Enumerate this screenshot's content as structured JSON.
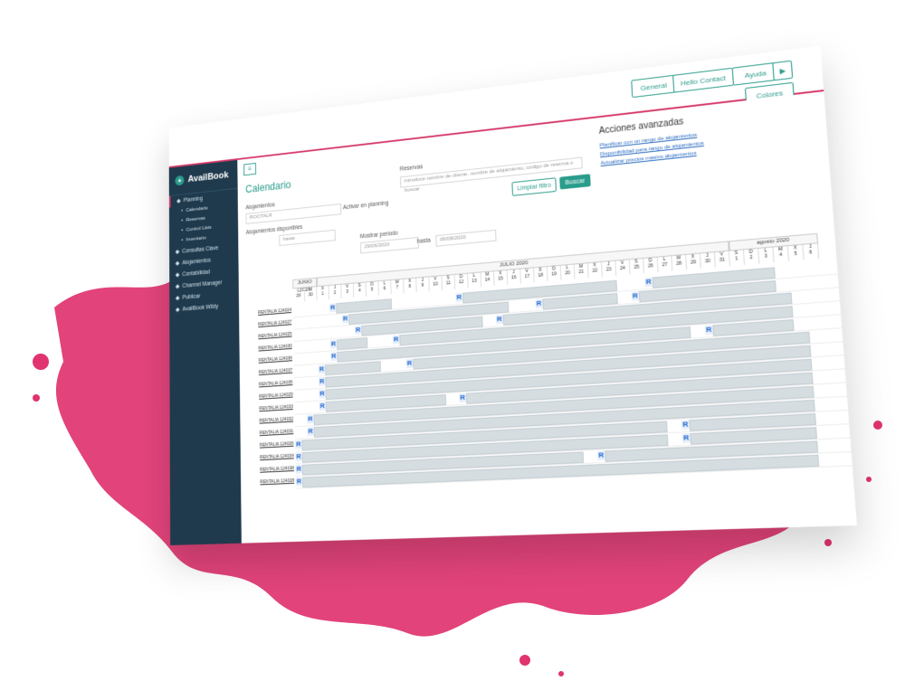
{
  "topbar": {
    "buttons": [
      "General",
      "Hello Contact",
      "Ayuda",
      "▶"
    ],
    "colores": "Colores"
  },
  "sidebar": {
    "logo": "AvailBook",
    "items": [
      {
        "label": "Planning",
        "sub": false,
        "active": true
      },
      {
        "label": "Calendario",
        "sub": true,
        "active": false
      },
      {
        "label": "Reservas",
        "sub": true,
        "active": false
      },
      {
        "label": "Control Lists",
        "sub": true,
        "active": false
      },
      {
        "label": "Inventario",
        "sub": true,
        "active": false
      },
      {
        "label": "Consultas Clave",
        "sub": false,
        "active": false
      },
      {
        "label": "Alojamientos",
        "sub": false,
        "active": false
      },
      {
        "label": "Contabilidad",
        "sub": false,
        "active": false
      },
      {
        "label": "Channel Manager",
        "sub": false,
        "active": false
      },
      {
        "label": "Publicar",
        "sub": false,
        "active": false
      },
      {
        "label": "AvailBook Wildy",
        "sub": false,
        "active": false
      }
    ]
  },
  "main": {
    "title": "Calendario",
    "alojamientos_label": "Alojamientos",
    "alojamientos_value": "ROOTALR",
    "ver_checkbox": "Activar en planning",
    "disponibles_label": "Alojamientos disponibles",
    "hasta": "hasta",
    "reservas_label": "Reservas",
    "reservas_placeholder": "Introduce nombre de cliente, nombre de alojamiento, código de reserva o buscar",
    "limpiar": "Limpiar filtro",
    "buscar": "Buscar",
    "mostrar_periodo": "Mostrar periodo",
    "fecha_desde": "29/06/2020",
    "hasta2": "hasta",
    "fecha_hasta": "06/08/2020",
    "acciones_title": "Acciones avanzadas",
    "acciones": [
      "Planificar con un rango de alojamientos",
      "Disponibilidad para rango de alojamientos",
      "Actualizar precios masivo alojamientos"
    ]
  },
  "calendar": {
    "months": [
      "JUNIO 2020",
      "JULIO 2020",
      "agosto 2020"
    ],
    "days": [
      "L",
      "M",
      "X",
      "J",
      "V",
      "S",
      "D",
      "L",
      "M",
      "X",
      "J",
      "V",
      "S",
      "D",
      "L",
      "M",
      "X",
      "J",
      "V",
      "S",
      "D",
      "L",
      "M",
      "X",
      "J",
      "V",
      "S",
      "D",
      "L",
      "M",
      "X",
      "J",
      "V",
      "S",
      "D",
      "L",
      "M",
      "X",
      "J"
    ],
    "nums": [
      "29",
      "30",
      "1",
      "2",
      "3",
      "4",
      "5",
      "6",
      "7",
      "8",
      "9",
      "10",
      "11",
      "12",
      "13",
      "14",
      "15",
      "16",
      "17",
      "18",
      "19",
      "20",
      "21",
      "22",
      "23",
      "24",
      "25",
      "26",
      "27",
      "28",
      "29",
      "30",
      "31",
      "1",
      "2",
      "3",
      "4",
      "5",
      "6"
    ],
    "rows": [
      "RENTALIA 124024",
      "RENTALIA 124027",
      "RENTALIA 124025",
      "RENTALIA 124030",
      "RENTALIA 124036",
      "RENTALIA 124037",
      "RENTALIA 124035",
      "RENTALIA 124029",
      "RENTALIA 124033",
      "RENTALIA 124032",
      "RENTALIA 124031",
      "RENTALIA 124026",
      "RENTALIA 124034",
      "RENTALIA 124038",
      "RENTALIA 124028"
    ]
  },
  "colors": {
    "accent": "#2a9c8c",
    "brand": "#d63a6a",
    "sidebar": "#1f3a4d"
  }
}
